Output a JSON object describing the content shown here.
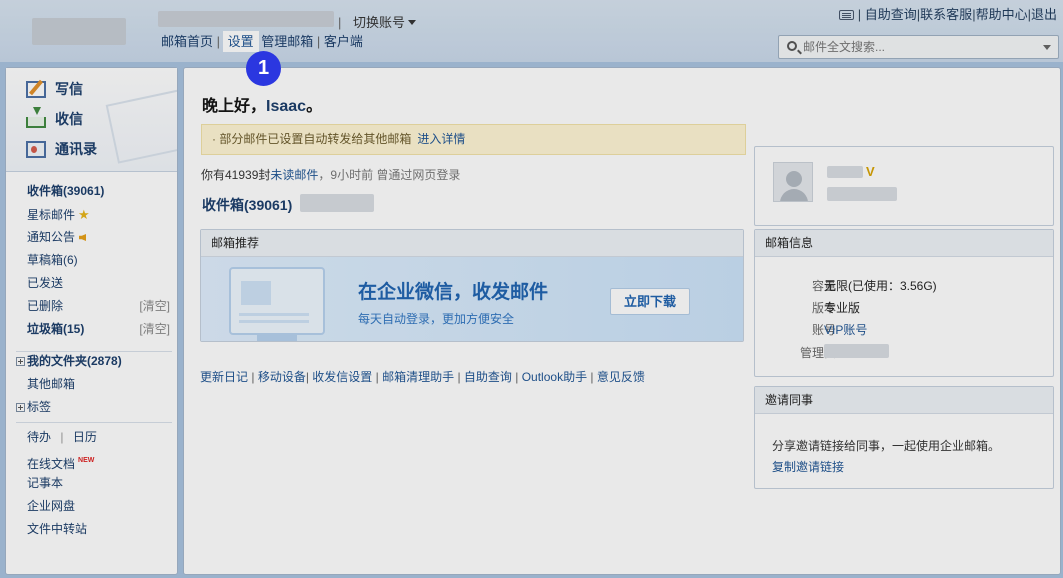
{
  "header": {
    "switch_account": "切换账号",
    "nav": [
      "邮箱首页",
      "设置",
      "管理邮箱",
      "客户端"
    ],
    "top_links": [
      "自助查询",
      "联系客服",
      "帮助中心",
      "退出"
    ],
    "search_placeholder": "邮件全文搜索..."
  },
  "step_badge": "1",
  "sidebar": {
    "quick": {
      "write": "写信",
      "receive": "收信",
      "contacts": "通讯录"
    },
    "folders": {
      "inbox": "收件箱(39061)",
      "starred": "星标邮件",
      "notice": "通知公告",
      "drafts": "草稿箱(6)",
      "sent": "已发送",
      "deleted": "已删除",
      "clear": "[清空]",
      "spam": "垃圾箱(15)"
    },
    "my_folders": "我的文件夹(2878)",
    "other_mail": "其他邮箱",
    "tags": "标签",
    "todo": "待办",
    "calendar": "日历",
    "online_docs": "在线文档",
    "new_tag": "NEW",
    "notes": "记事本",
    "netdisk": "企业网盘",
    "transfer": "文件中转站"
  },
  "main": {
    "greeting": "晚上好，",
    "user": "Isaac",
    "greeting_end": "。",
    "notice": "· 部分邮件已设置自动转发给其他邮箱",
    "notice_link": "进入详情",
    "unread_prefix": "你有41939封",
    "unread_link": "未读邮件",
    "unread_suffix": "，9小时前 曾通过网页登录",
    "inbox_title": "收件箱(39061)",
    "recommend": {
      "title": "邮箱推荐",
      "headline": "在企业微信，收发邮件",
      "sub": "每天自动登录，更加方便安全",
      "button": "立即下载"
    },
    "bottom_links": [
      "更新日记",
      "移动设备",
      "收发信设置",
      "邮箱清理助手",
      "自助查询",
      "Outlook助手",
      "意见反馈"
    ]
  },
  "profile": {
    "vip_mark": "V"
  },
  "mail_info": {
    "title": "邮箱信息",
    "capacity_label": "容量",
    "capacity_value": "无限(已使用：3.56G)",
    "version_label": "版本",
    "version_value": "专业版",
    "account_label": "账号",
    "account_value": "VIP账号",
    "admin_label": "管理员"
  },
  "invite": {
    "title": "邀请同事",
    "text": "分享邀请链接给同事，一起使用企业邮箱。",
    "link": "复制邀请链接"
  }
}
